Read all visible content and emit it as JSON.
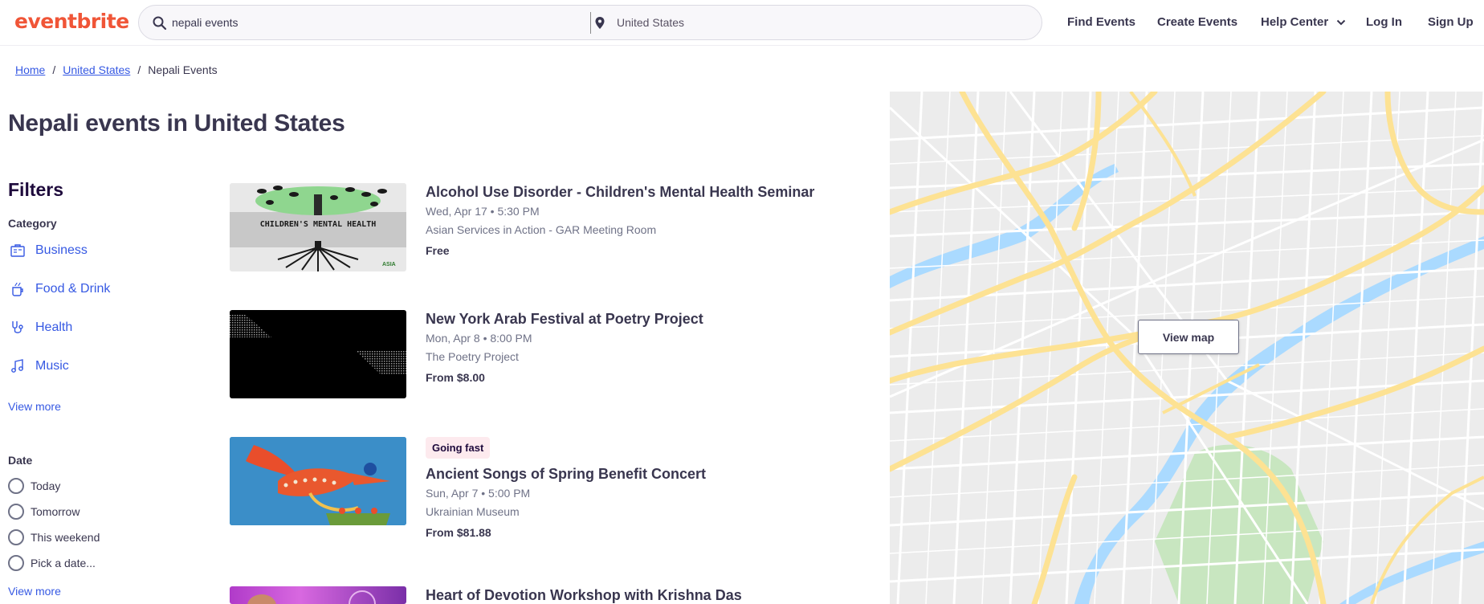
{
  "header": {
    "logo": "eventbrite",
    "search_value": "nepali events",
    "location_value": "United States",
    "nav": [
      "Find Events",
      "Create Events",
      "Help Center",
      "Log In",
      "Sign Up"
    ]
  },
  "breadcrumb": {
    "home": "Home",
    "country": "United States",
    "current": "Nepali Events",
    "separator": "/"
  },
  "page_title": "Nepali events in United States",
  "filters": {
    "title": "Filters",
    "category_label": "Category",
    "categories": [
      "Business",
      "Food & Drink",
      "Health",
      "Music"
    ],
    "category_view_more": "View more",
    "date_label": "Date",
    "dates": [
      "Today",
      "Tomorrow",
      "This weekend",
      "Pick a date..."
    ],
    "date_view_more": "View more"
  },
  "events": [
    {
      "title": "Alcohol Use Disorder - Children's Mental Health Seminar",
      "date": "Wed, Apr 17 • 5:30 PM",
      "venue": "Asian Services in Action - GAR Meeting Room",
      "price": "Free",
      "image_text": "CHILDREN'S MENTAL HEALTH",
      "image_subtext": "ASIA"
    },
    {
      "title": "New York Arab Festival at Poetry Project",
      "date": "Mon, Apr 8 • 8:00 PM",
      "venue": "The Poetry Project",
      "price": "From $8.00"
    },
    {
      "badge": "Going fast",
      "title": "Ancient Songs of Spring Benefit Concert",
      "date": "Sun, Apr 7 • 5:00 PM",
      "venue": "Ukrainian Museum",
      "price": "From $81.88"
    },
    {
      "title": "Heart of Devotion Workshop with Krishna Das"
    }
  ],
  "map": {
    "button_label": "View map",
    "colors": {
      "background": "#ececec",
      "roads": "#ffffff",
      "highways": "#fde293",
      "water": "#aadaff",
      "park": "#c8e6c0"
    }
  },
  "colors": {
    "brand": "#f05537",
    "link": "#3659e3",
    "text": "#39364f"
  }
}
